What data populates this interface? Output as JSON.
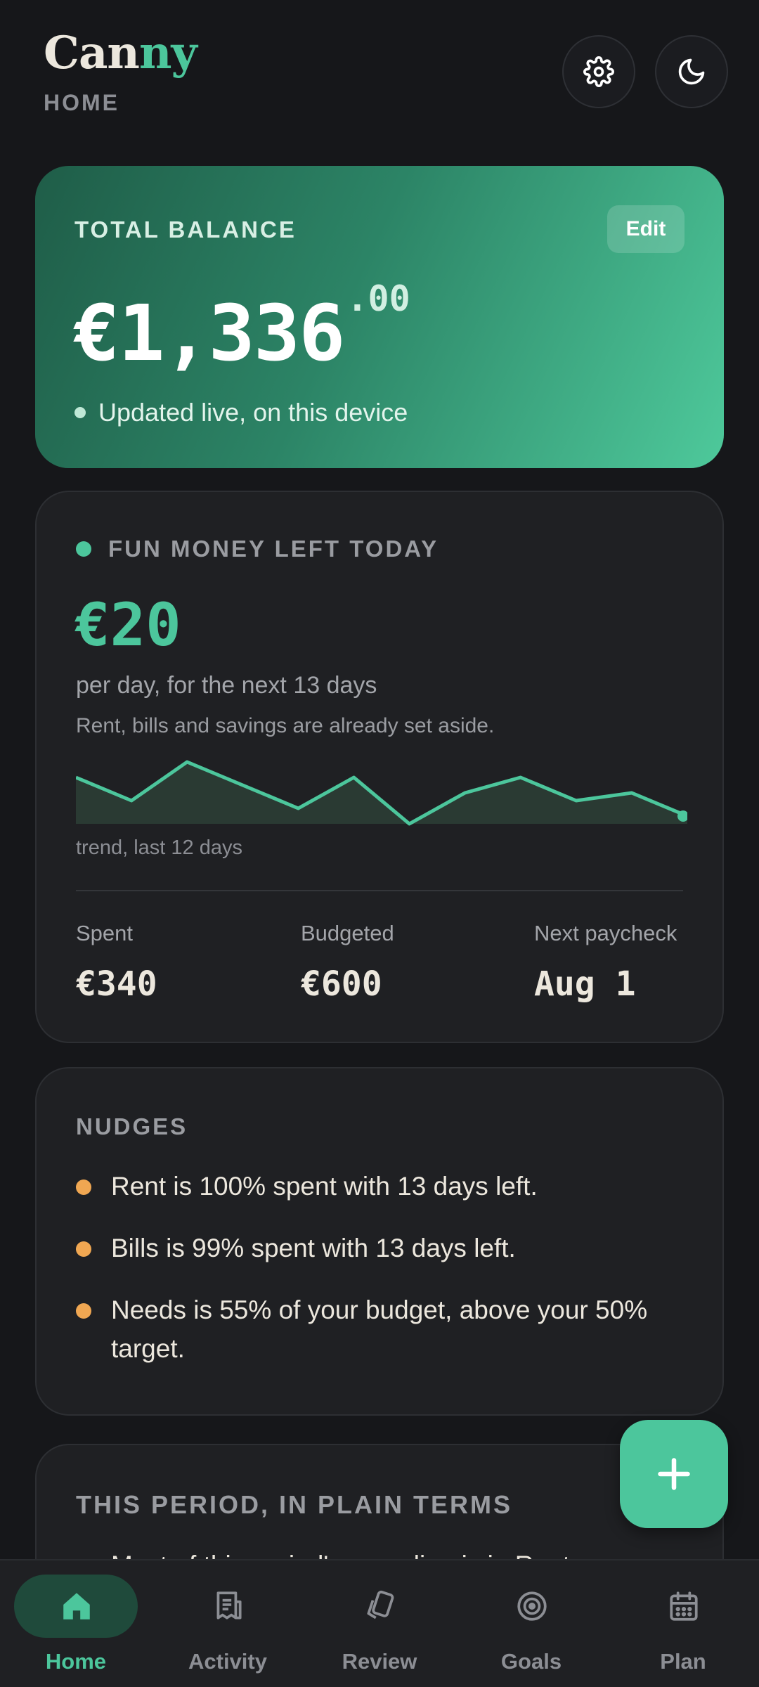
{
  "header": {
    "logo_part1": "Can",
    "logo_part2": "ny",
    "subtitle": "HOME"
  },
  "balance": {
    "label": "TOTAL BALANCE",
    "edit_label": "Edit",
    "amount_main": "€1,336",
    "amount_cents": ".00",
    "status": "Updated live, on this device"
  },
  "fun_money": {
    "label": "FUN MONEY LEFT TODAY",
    "amount": "€20",
    "per_day": "per day, for the next 13 days",
    "note": "Rent, bills and savings are already set aside.",
    "trend_label": "trend, last 12 days",
    "trend_values": [
      6,
      3,
      8,
      5,
      2,
      6,
      0,
      4,
      6,
      3,
      4,
      1
    ],
    "stats": [
      {
        "label": "Spent",
        "value": "€340"
      },
      {
        "label": "Budgeted",
        "value": "€600"
      },
      {
        "label": "Next paycheck",
        "value": "Aug 1"
      }
    ]
  },
  "nudges": {
    "title": "NUDGES",
    "items": [
      "Rent is 100% spent with 13 days left.",
      "Bills is 99% spent with 13 days left.",
      "Needs is 55% of your budget, above your 50% target."
    ]
  },
  "period": {
    "title": "THIS PERIOD, IN PLAIN TERMS",
    "first_item": "Most of this period's spending is in Rent."
  },
  "fab": {
    "icon": "plus-icon"
  },
  "nav": {
    "items": [
      {
        "label": "Home",
        "icon": "home-icon"
      },
      {
        "label": "Activity",
        "icon": "receipt-icon"
      },
      {
        "label": "Review",
        "icon": "cards-icon"
      },
      {
        "label": "Goals",
        "icon": "target-icon"
      },
      {
        "label": "Plan",
        "icon": "calendar-icon"
      }
    ]
  },
  "colors": {
    "accent": "#4cc69c",
    "warning": "#f0a752",
    "background": "#16171a",
    "card": "#1f2023"
  }
}
